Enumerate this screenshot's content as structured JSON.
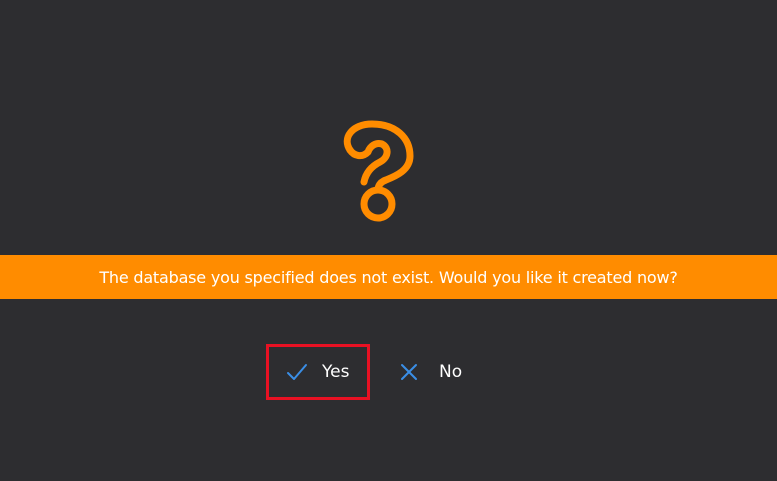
{
  "dialog": {
    "icon": "question-mark-icon",
    "message": "The database you specified does not exist. Would you like it created now?",
    "accent_color": "#ff8c00",
    "background_color": "#2d2d30",
    "focus_color": "#e81123"
  },
  "buttons": {
    "yes": {
      "label": "Yes",
      "icon": "checkmark-icon",
      "icon_color": "#3a8ee6"
    },
    "no": {
      "label": "No",
      "icon": "close-icon",
      "icon_color": "#3a8ee6"
    }
  }
}
